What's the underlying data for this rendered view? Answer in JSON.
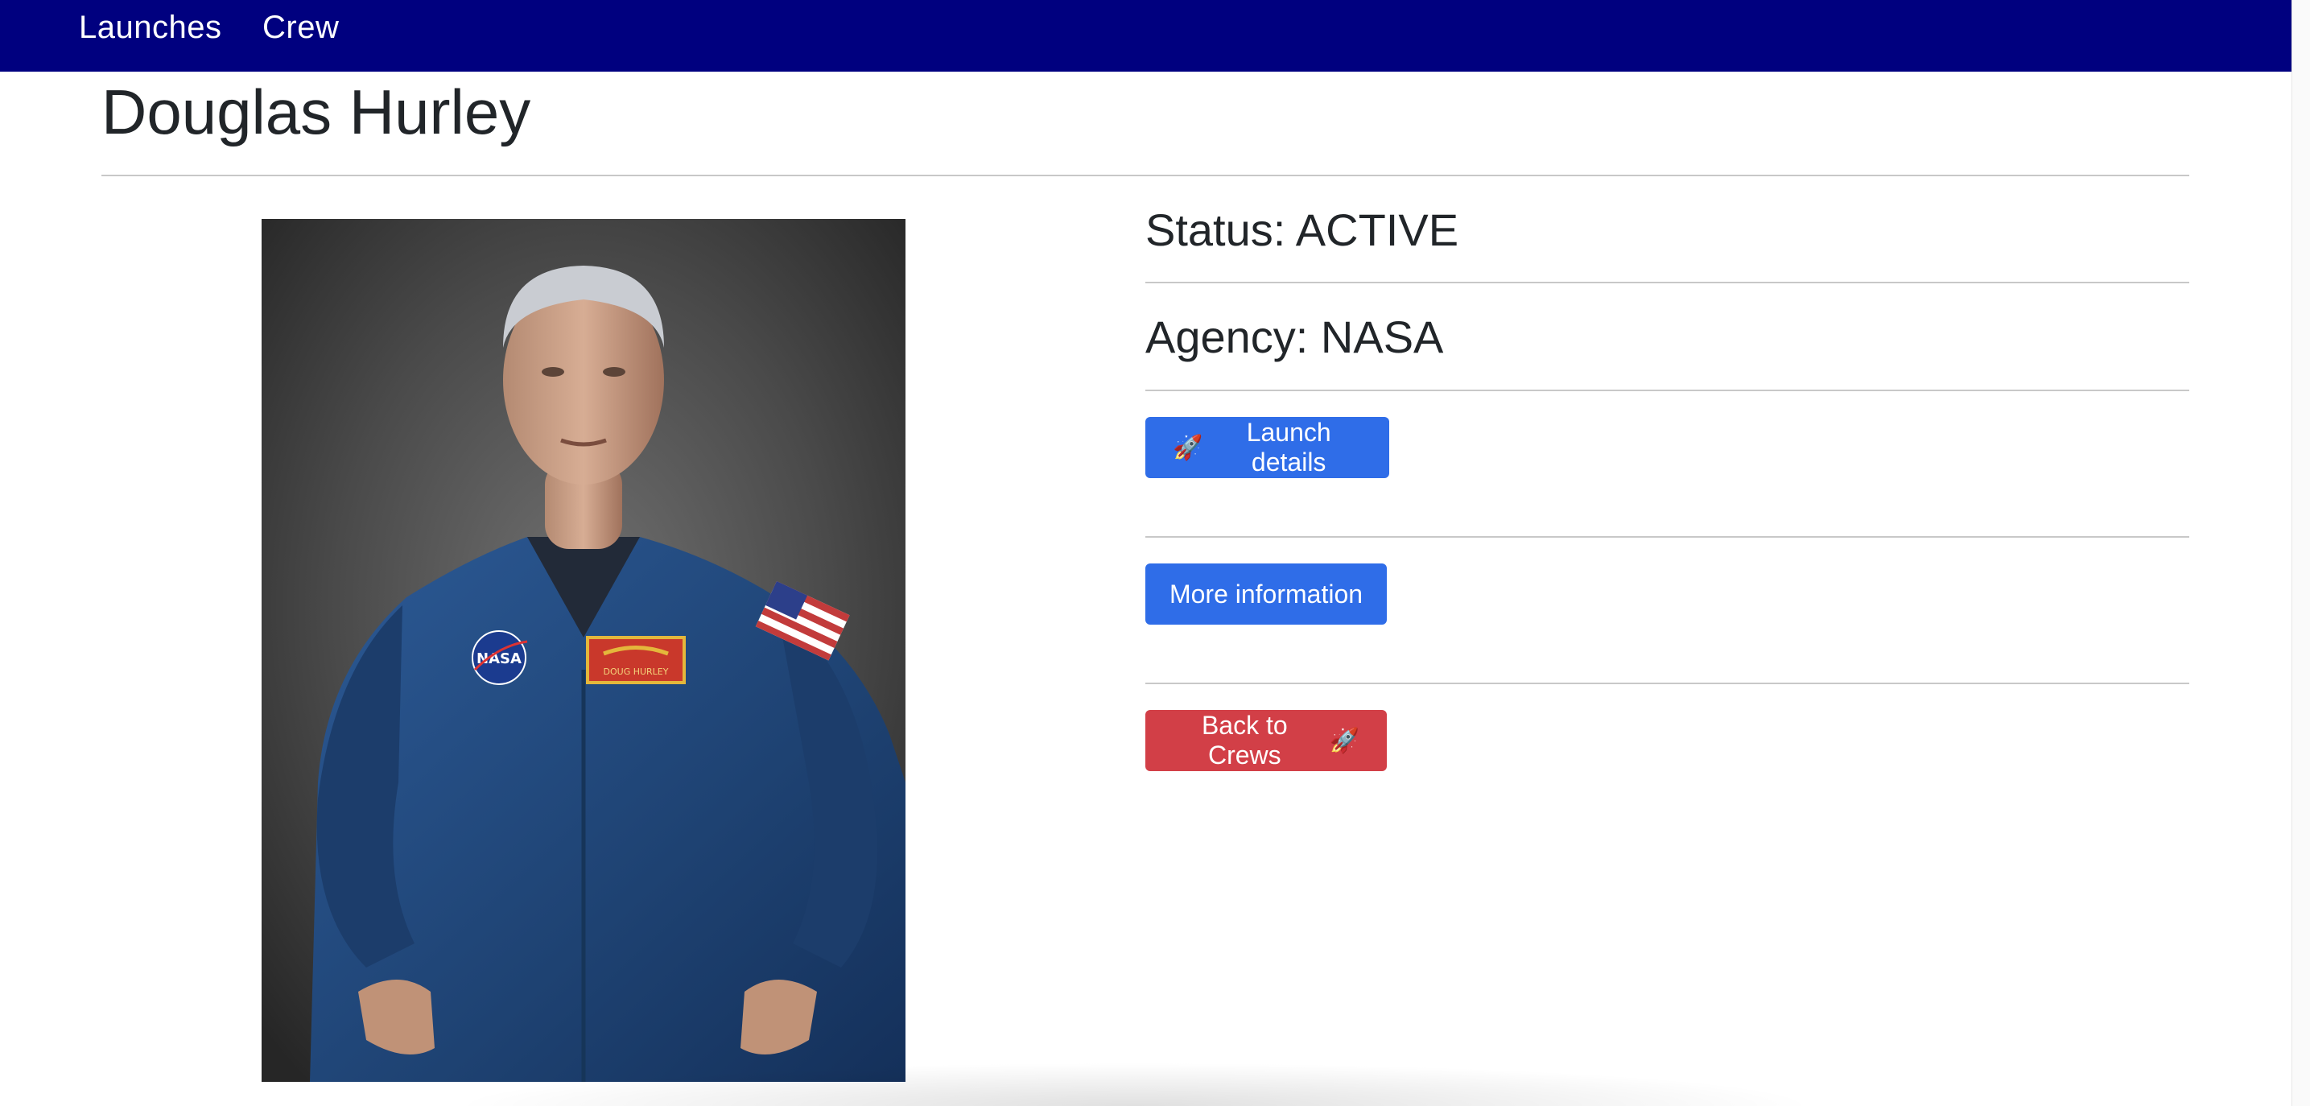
{
  "nav": {
    "items": [
      {
        "label": "Launches"
      },
      {
        "label": "Crew"
      }
    ]
  },
  "crew_member": {
    "name": "Douglas Hurley",
    "status_text": "Status: ACTIVE",
    "agency_text": "Agency: NASA",
    "photo_name_tag": "DOUG HURLEY",
    "photo_patch": "NASA"
  },
  "actions": {
    "launch_details_label": "Launch details",
    "more_information_label": "More information",
    "back_to_crews_label": "Back to Crews"
  },
  "icons": {
    "launch_details_icon": "rocket-icon",
    "back_to_crews_icon": "rocket-icon"
  },
  "colors": {
    "navbar": "#00007f",
    "primary_button": "#2f6de8",
    "danger_button": "#d23f47"
  }
}
